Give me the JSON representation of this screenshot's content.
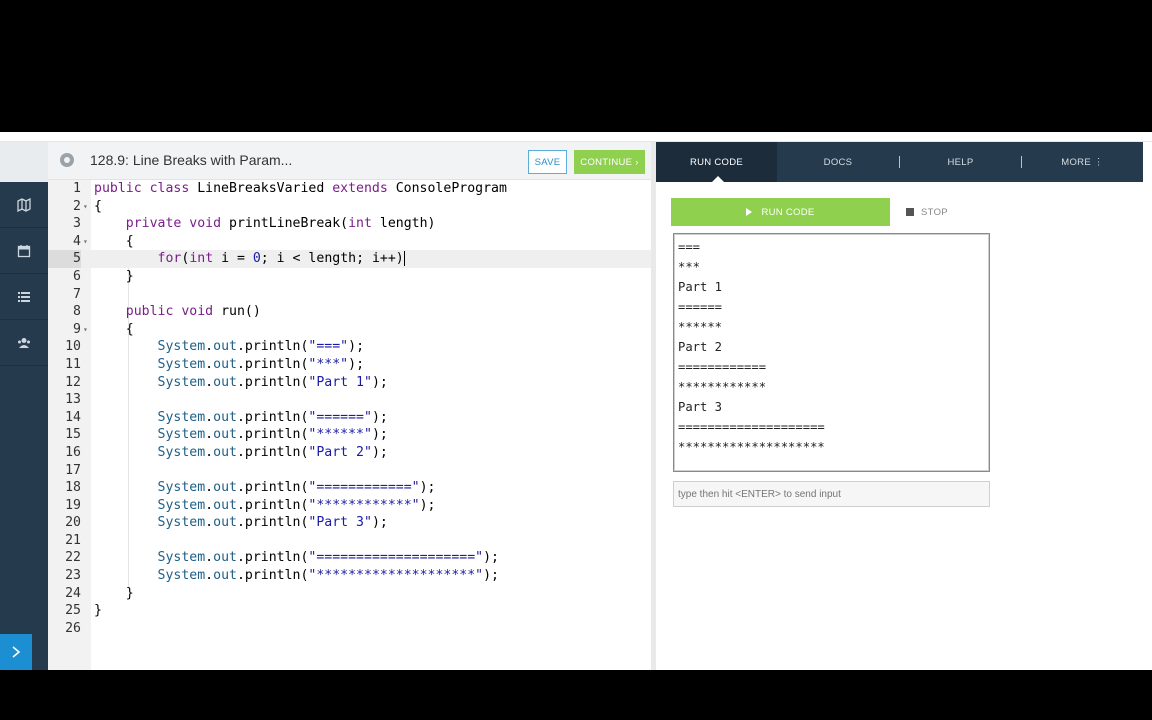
{
  "editor_header": {
    "title": "128.9: Line Breaks with Param...",
    "save_label": "SAVE",
    "continue_label": "CONTINUE ›"
  },
  "code": {
    "active_line": 5,
    "lines": [
      {
        "n": "1",
        "fold": "",
        "text": "public class LineBreaksVaried extends ConsoleProgram"
      },
      {
        "n": "2",
        "fold": "▾",
        "text": "{"
      },
      {
        "n": "3",
        "fold": "",
        "text": "    private void printLineBreak(int length)"
      },
      {
        "n": "4",
        "fold": "▾",
        "text": "    {"
      },
      {
        "n": "5",
        "fold": "",
        "text": "        for(int i = 0; i < length; i++)"
      },
      {
        "n": "6",
        "fold": "",
        "text": "    }"
      },
      {
        "n": "7",
        "fold": "",
        "text": ""
      },
      {
        "n": "8",
        "fold": "",
        "text": "    public void run()"
      },
      {
        "n": "9",
        "fold": "▾",
        "text": "    {"
      },
      {
        "n": "10",
        "fold": "",
        "text": "        System.out.println(\"===\");"
      },
      {
        "n": "11",
        "fold": "",
        "text": "        System.out.println(\"***\");"
      },
      {
        "n": "12",
        "fold": "",
        "text": "        System.out.println(\"Part 1\");"
      },
      {
        "n": "13",
        "fold": "",
        "text": ""
      },
      {
        "n": "14",
        "fold": "",
        "text": "        System.out.println(\"======\");"
      },
      {
        "n": "15",
        "fold": "",
        "text": "        System.out.println(\"******\");"
      },
      {
        "n": "16",
        "fold": "",
        "text": "        System.out.println(\"Part 2\");"
      },
      {
        "n": "17",
        "fold": "",
        "text": ""
      },
      {
        "n": "18",
        "fold": "",
        "text": "        System.out.println(\"============\");"
      },
      {
        "n": "19",
        "fold": "",
        "text": "        System.out.println(\"************\");"
      },
      {
        "n": "20",
        "fold": "",
        "text": "        System.out.println(\"Part 3\");"
      },
      {
        "n": "21",
        "fold": "",
        "text": ""
      },
      {
        "n": "22",
        "fold": "",
        "text": "        System.out.println(\"====================\");"
      },
      {
        "n": "23",
        "fold": "",
        "text": "        System.out.println(\"********************\");"
      },
      {
        "n": "24",
        "fold": "",
        "text": "    }"
      },
      {
        "n": "25",
        "fold": "",
        "text": "}"
      },
      {
        "n": "26",
        "fold": "",
        "text": ""
      }
    ]
  },
  "tabs": [
    {
      "label": "RUN CODE",
      "active": true
    },
    {
      "label": "DOCS",
      "active": false
    },
    {
      "label": "HELP",
      "active": false
    },
    {
      "label": "MORE ⋮",
      "active": false
    }
  ],
  "run": {
    "run_label": "RUN CODE",
    "stop_label": "STOP"
  },
  "console": {
    "output": [
      "===",
      "***",
      "Part 1",
      "======",
      "******",
      "Part 2",
      "============",
      "************",
      "Part 3",
      "====================",
      "********************"
    ],
    "input_placeholder": "type then hit <ENTER> to send input"
  },
  "nav": {
    "icons": [
      "map-icon",
      "calendar-icon",
      "list-icon",
      "users-icon"
    ],
    "expand_icon": "chevron-right-icon"
  },
  "colors": {
    "nav_bg": "#263a4d",
    "accent_green": "#8fd14f",
    "accent_blue": "#1b8fd2",
    "keyword": "#7a1e8a",
    "string": "#1a1aa6"
  }
}
